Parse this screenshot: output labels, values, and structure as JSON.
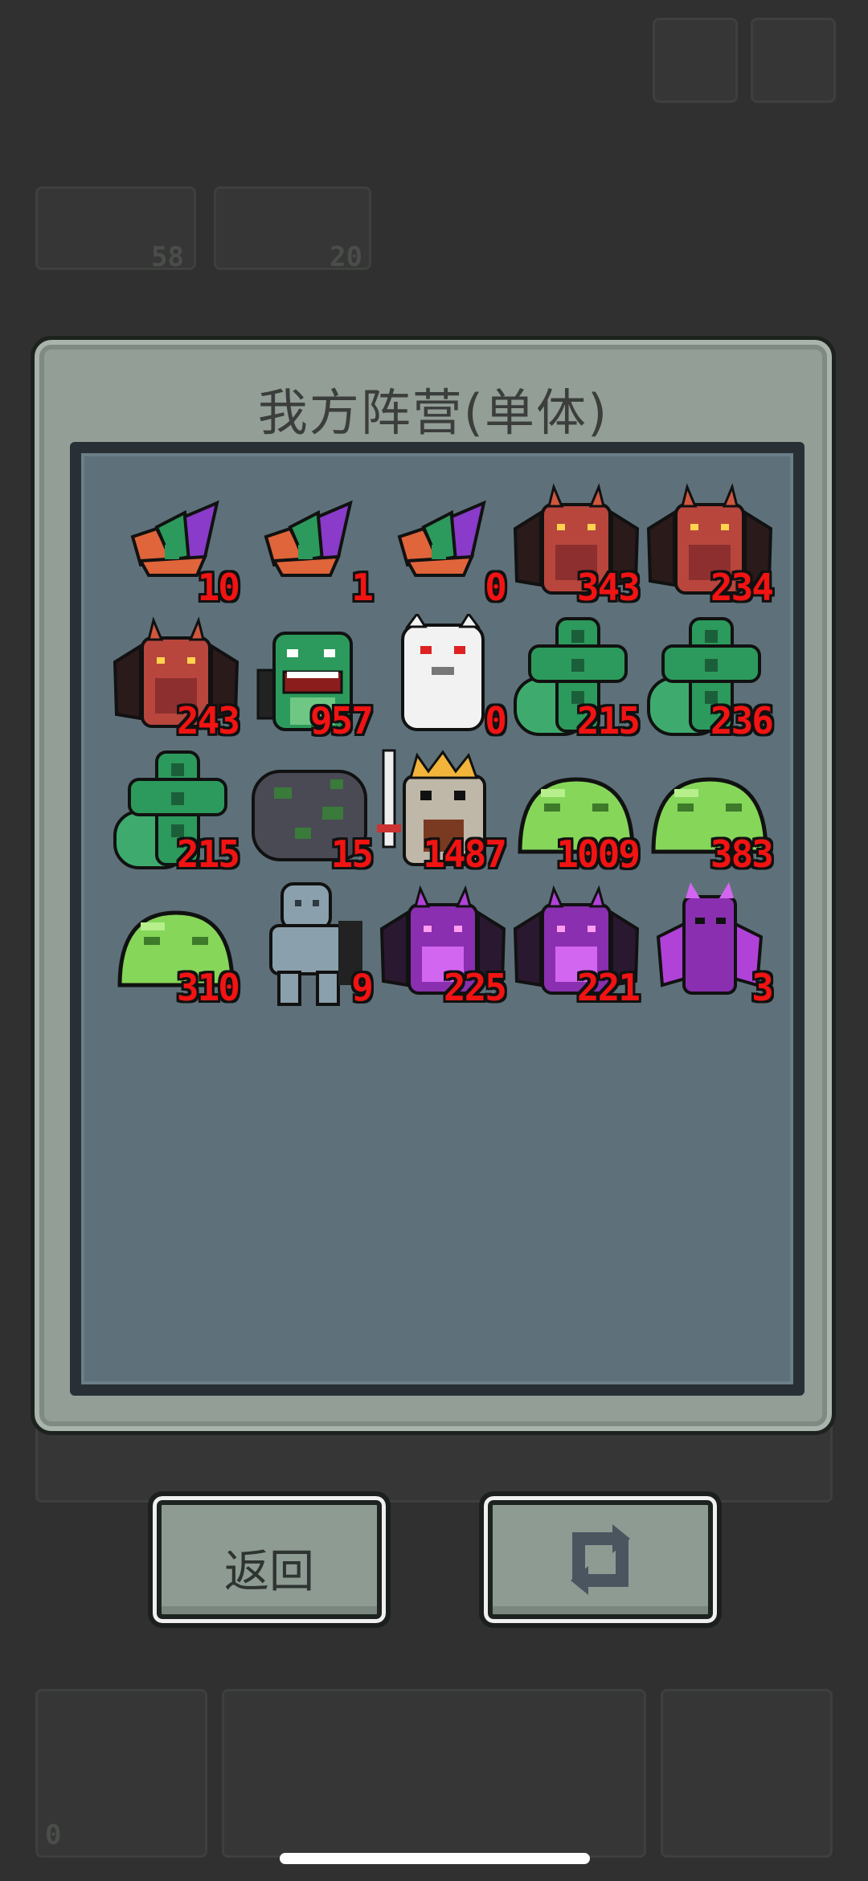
{
  "modal": {
    "title": "我方阵营(单体)",
    "units": [
      {
        "kind": "sprout",
        "count": "10"
      },
      {
        "kind": "sprout",
        "count": "1"
      },
      {
        "kind": "sprout",
        "count": "0"
      },
      {
        "kind": "red-dragon",
        "count": "343"
      },
      {
        "kind": "red-dragon",
        "count": "234"
      },
      {
        "kind": "red-dragon",
        "count": "243"
      },
      {
        "kind": "green-lizard",
        "count": "957"
      },
      {
        "kind": "white-ghost",
        "count": "0"
      },
      {
        "kind": "green-worm",
        "count": "215"
      },
      {
        "kind": "green-worm",
        "count": "236"
      },
      {
        "kind": "green-worm",
        "count": "215"
      },
      {
        "kind": "rock-golem",
        "count": "15"
      },
      {
        "kind": "skeleton-king",
        "count": "1487"
      },
      {
        "kind": "green-slime",
        "count": "1009"
      },
      {
        "kind": "green-slime",
        "count": "383"
      },
      {
        "kind": "green-slime",
        "count": "310"
      },
      {
        "kind": "grey-zombie",
        "count": "9"
      },
      {
        "kind": "purple-dragon",
        "count": "225"
      },
      {
        "kind": "purple-dragon",
        "count": "221"
      },
      {
        "kind": "purple-imp",
        "count": "3"
      }
    ]
  },
  "buttons": {
    "back_label": "返回",
    "refresh_icon": "refresh-icon"
  },
  "background": {
    "counter_a": "58",
    "counter_b": "20",
    "bottom_left_count": "0"
  },
  "colors": {
    "count_red": "#f21313",
    "panel": "#5e717a",
    "modal": "#939e96"
  }
}
